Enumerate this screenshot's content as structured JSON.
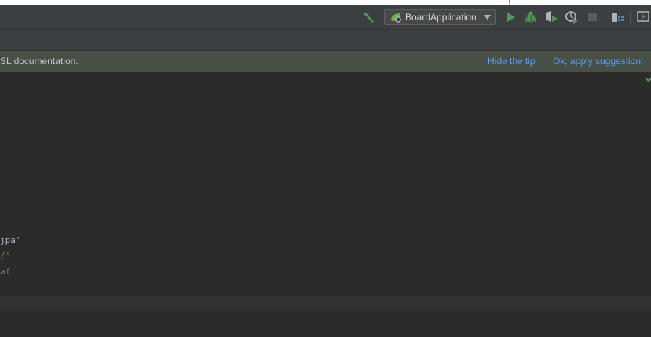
{
  "toolbar": {
    "build_icon": "hammer-icon",
    "run_config": {
      "label": "BoardApplication",
      "icon": "spring-boot-icon"
    },
    "actions": [
      {
        "name": "run-icon",
        "color": "#499c54"
      },
      {
        "name": "debug-icon",
        "color": "#499c54"
      },
      {
        "name": "coverage-icon"
      },
      {
        "name": "profile-icon"
      },
      {
        "name": "stop-icon"
      },
      {
        "name": "project-structure-icon"
      },
      {
        "name": "presentation-icon"
      }
    ]
  },
  "banner": {
    "text": "SL documentation.",
    "hide_tip": "Hide the tip",
    "apply": "Ok, apply suggestion!"
  },
  "editor": {
    "lines": [
      {
        "text": "jpa'",
        "style": "gray"
      },
      {
        "text": "/'",
        "style": "green"
      },
      {
        "text": "af'",
        "style": "green"
      }
    ]
  },
  "colors": {
    "accent_link": "#589df6",
    "run_green": "#499c54",
    "banner_bg": "#485046",
    "editor_bg": "#2b2b2b"
  }
}
